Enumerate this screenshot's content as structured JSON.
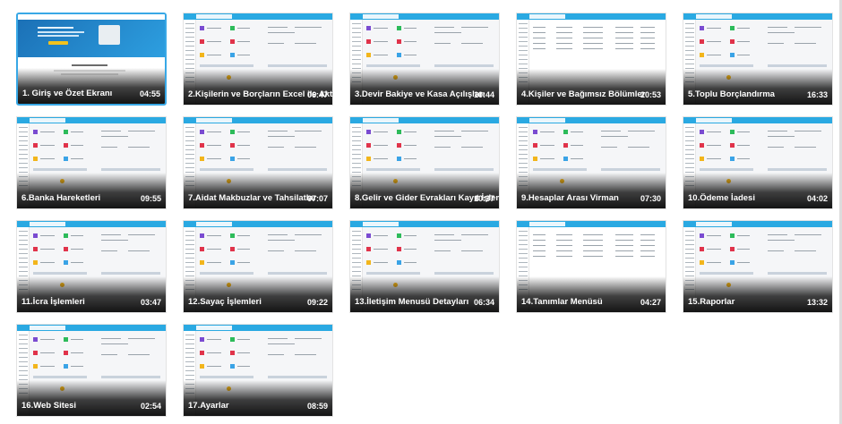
{
  "videos": [
    {
      "title": "1. Giriş ve Özet Ekranı",
      "duration": "04:55",
      "active": true,
      "thumb": "intro"
    },
    {
      "title": "2.Kişilerin ve Borçların Excel ile Akt",
      "duration": "06:47",
      "active": false,
      "thumb": "dashboard"
    },
    {
      "title": "3.Devir Bakiye ve Kasa Açılışları",
      "duration": "10:44",
      "active": false,
      "thumb": "dashboard"
    },
    {
      "title": "4.Kişiler ve Bağımsız Bölümler",
      "duration": "20:53",
      "active": false,
      "thumb": "table"
    },
    {
      "title": "5.Toplu Borçlandırma",
      "duration": "16:33",
      "active": false,
      "thumb": "dashboard"
    },
    {
      "title": "6.Banka Hareketleri",
      "duration": "09:55",
      "active": false,
      "thumb": "dashboard"
    },
    {
      "title": "7.Aidat Makbuzlar ve Tahsilatlar",
      "duration": "07:07",
      "active": false,
      "thumb": "dashboard"
    },
    {
      "title": "8.Gelir ve Gider Evrakları Kayıt İşlem",
      "duration": "10:37",
      "active": false,
      "thumb": "dashboard"
    },
    {
      "title": "9.Hesaplar Arası Virman",
      "duration": "07:30",
      "active": false,
      "thumb": "dashboard"
    },
    {
      "title": "10.Ödeme İadesi",
      "duration": "04:02",
      "active": false,
      "thumb": "dashboard"
    },
    {
      "title": "11.İcra İşlemleri",
      "duration": "03:47",
      "active": false,
      "thumb": "dashboard"
    },
    {
      "title": "12.Sayaç İşlemleri",
      "duration": "09:22",
      "active": false,
      "thumb": "dashboard"
    },
    {
      "title": "13.İletişim Menusü Detayları",
      "duration": "06:34",
      "active": false,
      "thumb": "dashboard"
    },
    {
      "title": "14.Tanımlar Menüsü",
      "duration": "04:27",
      "active": false,
      "thumb": "table"
    },
    {
      "title": "15.Raporlar",
      "duration": "13:32",
      "active": false,
      "thumb": "dashboard"
    },
    {
      "title": "16.Web Sitesi",
      "duration": "02:54",
      "active": false,
      "thumb": "dashboard"
    },
    {
      "title": "17.Ayarlar",
      "duration": "08:59",
      "active": false,
      "thumb": "dashboard"
    }
  ],
  "colors": {
    "accent": "#38a8e6",
    "app_header": "#2aa9e2",
    "tile_purple": "#7a4bd1",
    "tile_green": "#2dbb5a",
    "tile_red": "#e0334a",
    "tile_orange": "#f2b51b",
    "tile_blue": "#3aa3e6"
  }
}
